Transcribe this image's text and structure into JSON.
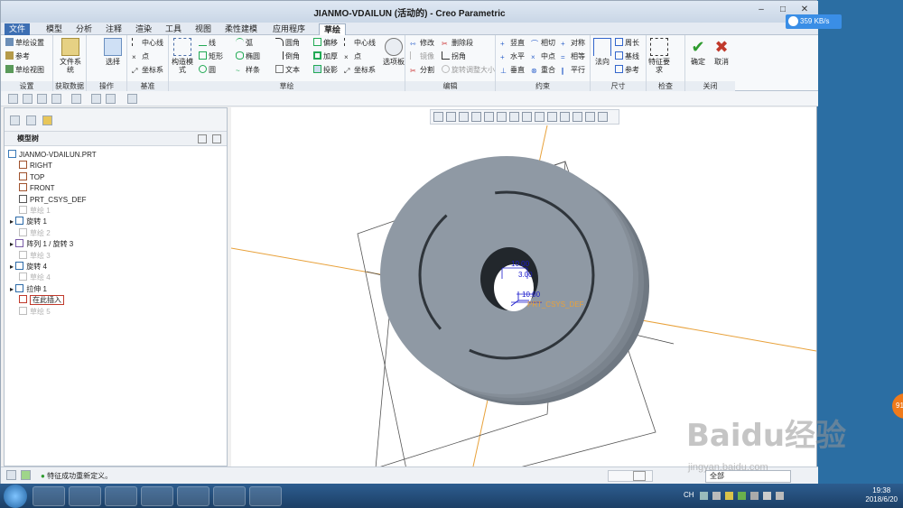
{
  "window": {
    "title": "JIANMO-VDAILUN (活动的) - Creo Parametric"
  },
  "net_speed": "359 KB/s",
  "tabs": [
    "文件",
    "模型",
    "分析",
    "注释",
    "渲染",
    "工具",
    "视图",
    "柔性建模",
    "应用程序",
    "草绘"
  ],
  "ribbon": {
    "setup": {
      "items": [
        "草绘设置",
        "参考",
        "草绘视图"
      ],
      "label": "设置"
    },
    "get_data": {
      "file_system": "文件系统",
      "label": "获取数据"
    },
    "operations": {
      "select": "选择",
      "label": "操作"
    },
    "datum": {
      "items": [
        "中心线",
        "点",
        "坐标系"
      ],
      "label": "基准"
    },
    "sketch": {
      "construction": "构造模式",
      "col1": [
        "线",
        "矩形",
        "圆"
      ],
      "col2": [
        "弧",
        "椭圆",
        "样条"
      ],
      "col3": [
        "圆角",
        "倒角",
        "文本"
      ],
      "col4": [
        "偏移",
        "加厚",
        "投影"
      ],
      "col5": [
        "中心线",
        "点",
        "坐标系"
      ],
      "palette": "选项板",
      "label": "草绘"
    },
    "edit": {
      "col1": [
        "修改",
        "镜像",
        "分割"
      ],
      "col2": [
        "删除段",
        "拐角",
        "旋转调整大小"
      ],
      "label": "编辑"
    },
    "constrain": {
      "col1": [
        "竖直",
        "水平",
        "垂直"
      ],
      "col2": [
        "相切",
        "中点",
        "重合"
      ],
      "col3": [
        "对称",
        "相等",
        "平行"
      ],
      "label": "约束"
    },
    "dimension": {
      "normal": "法向",
      "items": [
        "周长",
        "基线",
        "参考"
      ],
      "label": "尺寸"
    },
    "inspect": {
      "feature_req": "特征要求",
      "label": "检查"
    },
    "close": {
      "ok": "确定",
      "cancel": "取消",
      "label": "关闭"
    }
  },
  "tree": {
    "header": "模型树",
    "items": [
      {
        "label": "JIANMO-VDAILUN.PRT",
        "dim": false,
        "icon": "part-icon"
      },
      {
        "label": "RIGHT",
        "dim": false,
        "icon": "plane-icon"
      },
      {
        "label": "TOP",
        "dim": false,
        "icon": "plane-icon"
      },
      {
        "label": "FRONT",
        "dim": false,
        "icon": "plane-icon"
      },
      {
        "label": "PRT_CSYS_DEF",
        "dim": false,
        "icon": "csys-icon"
      },
      {
        "label": "草绘 1",
        "dim": true,
        "icon": "sketch-icon"
      },
      {
        "label": "旋转 1",
        "dim": false,
        "icon": "revolve-icon"
      },
      {
        "label": "草绘 2",
        "dim": true,
        "icon": "sketch-icon"
      },
      {
        "label": "阵列 1 / 旋转 3",
        "dim": false,
        "icon": "pattern-icon"
      },
      {
        "label": "草绘 3",
        "dim": true,
        "icon": "sketch-icon"
      },
      {
        "label": "旋转 4",
        "dim": false,
        "icon": "revolve-icon"
      },
      {
        "label": "草绘 4",
        "dim": true,
        "icon": "sketch-icon"
      },
      {
        "label": "拉伸 1",
        "dim": false,
        "icon": "extrude-icon"
      },
      {
        "label": "在此插入",
        "dim": false,
        "icon": "insert-arrow-icon"
      },
      {
        "label": "草绘 5",
        "dim": true,
        "icon": "sketch-icon"
      }
    ]
  },
  "viewport": {
    "dims": [
      "10.00",
      "3.00",
      "10.00"
    ],
    "csys_label": "PRT_CSYS_DEF"
  },
  "status": {
    "message": "特征成功重新定义。",
    "filter": "全部"
  },
  "clock": {
    "time": "19:38",
    "date": "2018/6/20"
  },
  "tray": {
    "lang": "CH"
  },
  "side_badge": "91",
  "watermark": {
    "brand": "Baidu经验",
    "url": "jingyan.baidu.com"
  },
  "colors": {
    "accent": "#3d6fb3",
    "part": "#8f99a4",
    "dim": "#1a1acc",
    "ok": "#2e9b2e",
    "cancel": "#c0392b"
  }
}
